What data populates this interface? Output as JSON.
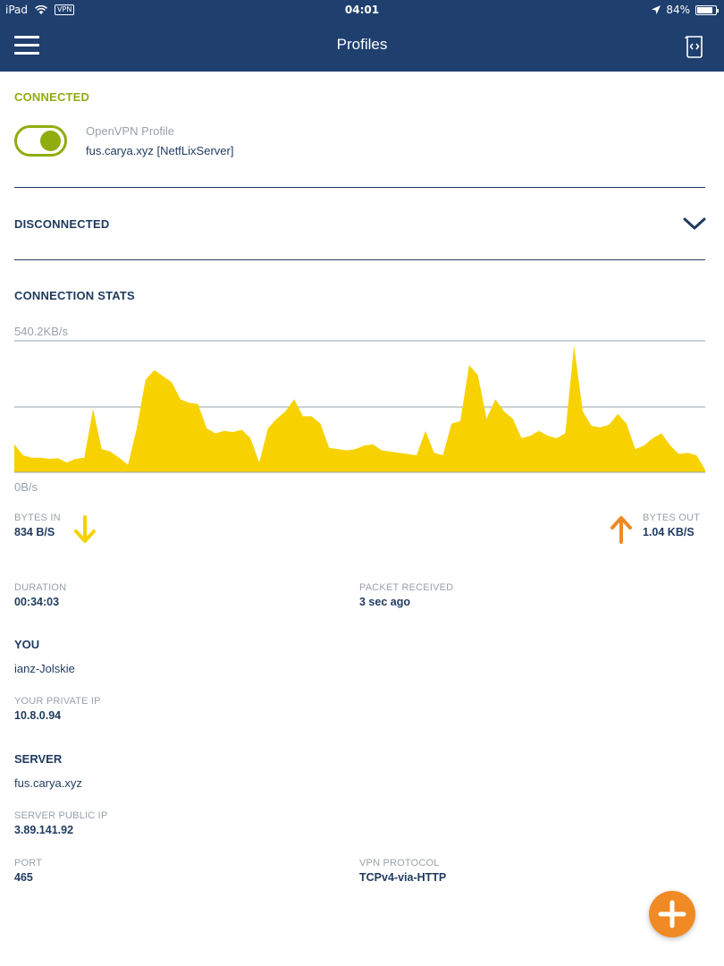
{
  "status_bar": {
    "device": "iPad",
    "vpn_badge": "VPN",
    "time": "04:01",
    "battery": "84%",
    "battery_level": 0.84
  },
  "header": {
    "title": "Profiles",
    "menu_icon": "hamburger-icon",
    "log_icon": "log-file-icon"
  },
  "connected_section": {
    "label": "CONNECTED",
    "toggle_on": true,
    "profile_type": "OpenVPN Profile",
    "profile_name": "fus.carya.xyz [NetfLixServer]"
  },
  "disconnected_section": {
    "label": "DISCONNECTED",
    "expand_icon": "chevron-down-icon"
  },
  "stats": {
    "label": "CONNECTION STATS",
    "bytes_in_label": "BYTES IN",
    "bytes_in_value": "834 B/S",
    "bytes_out_label": "BYTES OUT",
    "bytes_out_value": "1.04 KB/S",
    "duration_label": "DURATION",
    "duration_value": "00:34:03",
    "packet_label": "PACKET RECEIVED",
    "packet_value": "3 sec ago"
  },
  "you": {
    "title": "YOU",
    "name": "ianz-Jolskie",
    "private_ip_label": "YOUR PRIVATE IP",
    "private_ip_value": "10.8.0.94"
  },
  "server": {
    "title": "SERVER",
    "name": "fus.carya.xyz",
    "public_ip_label": "SERVER PUBLIC IP",
    "public_ip_value": "3.89.141.92",
    "port_label": "PORT",
    "port_value": "465",
    "protocol_label": "VPN PROTOCOL",
    "protocol_value": "TCPv4-via-HTTP"
  },
  "fab": {
    "icon": "plus-icon"
  },
  "colors": {
    "navy": "#1f3f6e",
    "green": "#8fad0e",
    "yellow": "#f7d200",
    "orange": "#f08a24"
  },
  "chart_data": {
    "type": "area",
    "ylim": [
      0,
      540.2
    ],
    "ymax_label": "540.2KB/s",
    "ymin_label": "0B/s",
    "x": [
      0,
      1,
      2,
      3,
      4,
      5,
      6,
      7,
      8,
      9,
      10,
      11,
      12,
      13,
      14,
      15,
      16,
      17,
      18,
      19,
      20,
      21,
      22,
      23,
      24,
      25,
      26,
      27,
      28,
      29,
      30,
      31,
      32,
      33,
      34,
      35,
      36,
      37,
      38,
      39,
      40,
      41,
      42,
      43,
      44,
      45,
      46,
      47,
      48,
      49,
      50,
      51,
      52,
      53,
      54,
      55,
      56,
      57,
      58,
      59,
      60,
      61,
      62,
      63,
      64,
      65,
      66,
      67,
      68,
      69,
      70,
      71,
      72,
      73,
      74,
      75,
      76,
      77,
      78,
      79
    ],
    "values": [
      115,
      70,
      60,
      60,
      55,
      58,
      40,
      55,
      60,
      260,
      95,
      85,
      60,
      30,
      180,
      380,
      420,
      395,
      370,
      300,
      285,
      280,
      180,
      160,
      170,
      165,
      175,
      140,
      40,
      180,
      220,
      250,
      300,
      230,
      230,
      200,
      100,
      95,
      90,
      95,
      110,
      115,
      90,
      85,
      80,
      75,
      70,
      170,
      80,
      70,
      200,
      210,
      440,
      400,
      220,
      300,
      250,
      220,
      140,
      150,
      170,
      150,
      140,
      160,
      520,
      250,
      190,
      185,
      195,
      240,
      200,
      95,
      110,
      140,
      160,
      110,
      75,
      80,
      70,
      10
    ]
  }
}
